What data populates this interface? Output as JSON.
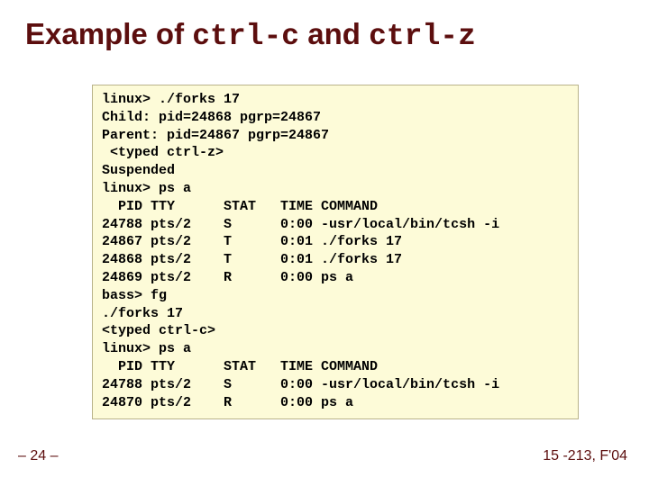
{
  "title": {
    "prefix": "Example of ",
    "code1": "ctrl-c",
    "mid": " and ",
    "code2": "ctrl-z"
  },
  "terminal_text": "linux> ./forks 17\nChild: pid=24868 pgrp=24867\nParent: pid=24867 pgrp=24867\n <typed ctrl-z>\nSuspended\nlinux> ps a\n  PID TTY      STAT   TIME COMMAND\n24788 pts/2    S      0:00 -usr/local/bin/tcsh -i\n24867 pts/2    T      0:01 ./forks 17\n24868 pts/2    T      0:01 ./forks 17\n24869 pts/2    R      0:00 ps a\nbass> fg\n./forks 17\n<typed ctrl-c>\nlinux> ps a\n  PID TTY      STAT   TIME COMMAND\n24788 pts/2    S      0:00 -usr/local/bin/tcsh -i\n24870 pts/2    R      0:00 ps a",
  "footer": {
    "page": "– 24 –",
    "course": "15 -213, F'04"
  }
}
